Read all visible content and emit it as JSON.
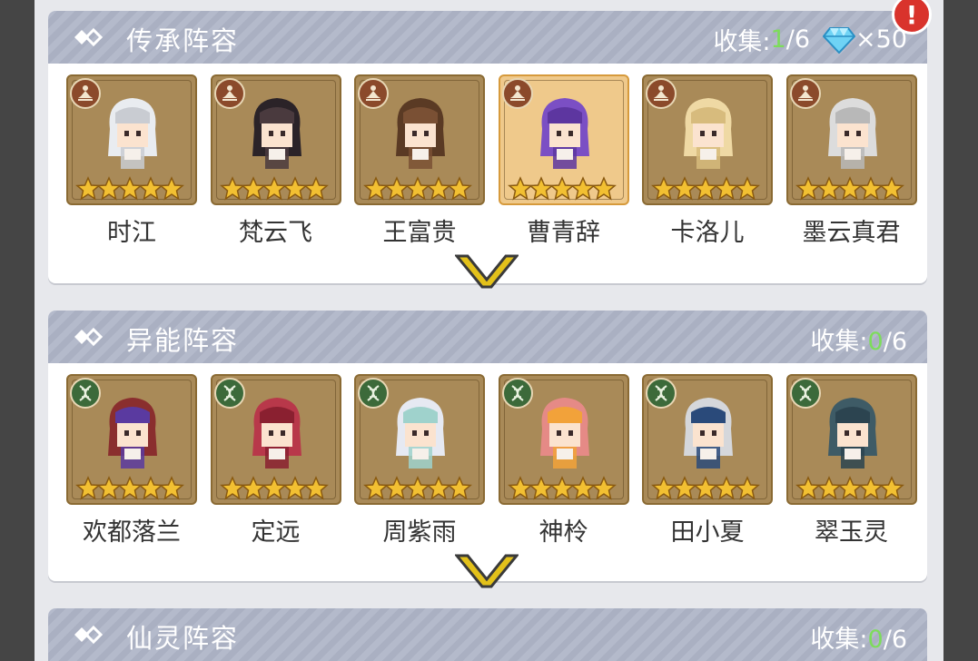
{
  "colors": {
    "header_bg": "#b0b6c8",
    "collect_count": "#7ddc5b",
    "card_frame": "#8a6a33",
    "card_bg": "#a98a58",
    "card_highlight": "#efc98b",
    "star": "#f2c032",
    "heritage_badge": "#8b4a2b",
    "ability_badge": "#3c6a3a",
    "chevron": "#e3c11a"
  },
  "notification": {
    "icon": "exclamation-icon",
    "text": "!"
  },
  "sections": [
    {
      "title": "传承阵容",
      "collect_label": "收集:",
      "collect_count": "1",
      "collect_total": "/6",
      "reward_icon": "diamond-icon",
      "reward_text": "×50",
      "badge_icon": "meditation-icon",
      "cards": [
        {
          "name": "时江",
          "stars": 5,
          "highlight": false
        },
        {
          "name": "梵云飞",
          "stars": 5,
          "highlight": false
        },
        {
          "name": "王富贵",
          "stars": 5,
          "highlight": false
        },
        {
          "name": "曹青辞",
          "stars": 5,
          "highlight": true
        },
        {
          "name": "卡洛儿",
          "stars": 5,
          "highlight": false
        },
        {
          "name": "墨云真君",
          "stars": 5,
          "highlight": false
        }
      ]
    },
    {
      "title": "异能阵容",
      "collect_label": "收集:",
      "collect_count": "0",
      "collect_total": "/6",
      "badge_icon": "dna-icon",
      "cards": [
        {
          "name": "欢都落兰",
          "stars": 5,
          "highlight": false
        },
        {
          "name": "定远",
          "stars": 5,
          "highlight": false
        },
        {
          "name": "周紫雨",
          "stars": 5,
          "highlight": false
        },
        {
          "name": "神柃",
          "stars": 5,
          "highlight": false
        },
        {
          "name": "田小夏",
          "stars": 5,
          "highlight": false
        },
        {
          "name": "翠玉灵",
          "stars": 5,
          "highlight": false
        }
      ]
    },
    {
      "title": "仙灵阵容",
      "collect_label": "收集:",
      "collect_count": "0",
      "collect_total": "/6"
    }
  ]
}
